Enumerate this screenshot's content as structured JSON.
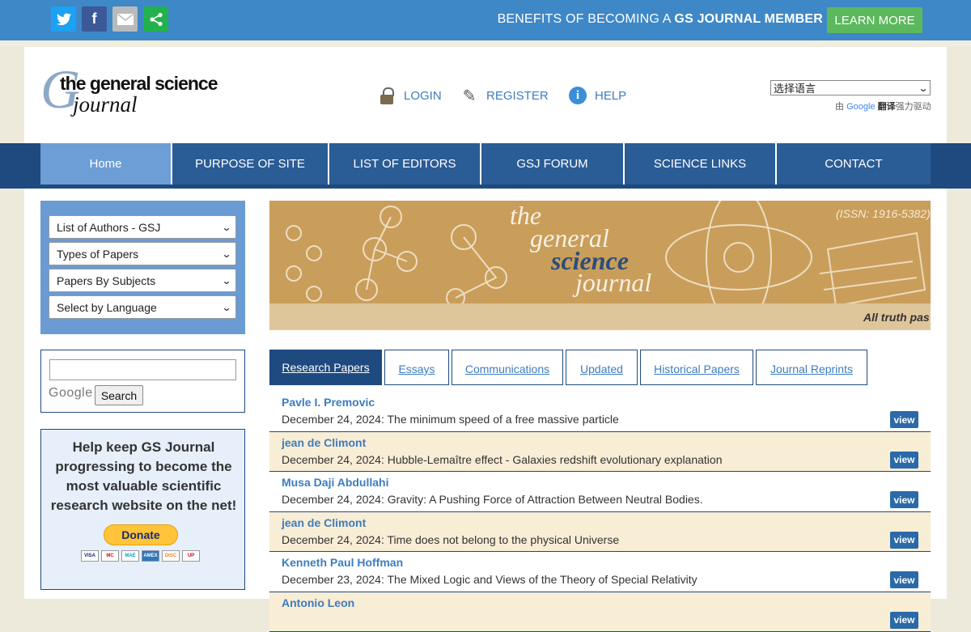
{
  "topbar": {
    "social": [
      "twitter-icon",
      "facebook-icon",
      "email-icon",
      "share-icon"
    ],
    "benefits_prefix": "BENEFITS OF BECOMING A ",
    "benefits_bold": "GS JOURNAL MEMBER",
    "learn_more": "LEARN MORE"
  },
  "logo": {
    "line1": "the general science",
    "line2": "journal"
  },
  "header_links": {
    "login": "LOGIN",
    "register": "REGISTER",
    "help": "HELP"
  },
  "translate": {
    "select_value": "选择语言",
    "powered_prefix": "由 ",
    "google": "Google",
    "translate_bold": "翻译",
    "powered_suffix": "强力驱动"
  },
  "nav": [
    {
      "label": "Home"
    },
    {
      "label": "PURPOSE OF SITE"
    },
    {
      "label": "LIST OF EDITORS"
    },
    {
      "label": "GSJ FORUM"
    },
    {
      "label": "SCIENCE LINKS"
    },
    {
      "label": "CONTACT"
    }
  ],
  "sidebar": {
    "selects": [
      "List of Authors - GSJ",
      "Types of Papers",
      "Papers By Subjects",
      "Select by Language"
    ],
    "search_button": "Search",
    "search_brand": "Google",
    "donate_text": "Help keep GS Journal progressing to become the most valuable scientific research website on the net!",
    "donate_button": "Donate",
    "cards": [
      "VISA",
      "MC",
      "MAE",
      "AMEX",
      "DISC",
      "UP"
    ]
  },
  "banner": {
    "line1": "the",
    "line2": "general",
    "line3": "science",
    "line4": "journal",
    "issn": "(ISSN: 1916-5382)",
    "tagline": "All truth pas"
  },
  "tabs": [
    "Research Papers",
    "Essays",
    "Communications",
    "Updated",
    "Historical Papers",
    "Journal Reprints"
  ],
  "papers": [
    {
      "author": "Pavle I. Premovic",
      "entry": "December 24, 2024: The minimum speed of a free massive particle",
      "view": "view"
    },
    {
      "author": "jean de Climont",
      "entry": "December 24, 2024: Hubble-Lemaître effect - Galaxies redshift evolutionary explanation",
      "view": "view"
    },
    {
      "author": "Musa Daji Abdullahi",
      "entry": "December 24, 2024: Gravity: A Pushing Force of Attraction Between Neutral Bodies.",
      "view": "view"
    },
    {
      "author": "jean de Climont",
      "entry": "December 24, 2024: Time does not belong to the physical Universe",
      "view": "view"
    },
    {
      "author": "Kenneth Paul Hoffman",
      "entry": "December 23, 2024: The Mixed Logic and Views of the Theory of Special Relativity",
      "view": "view"
    },
    {
      "author": "Antonio Leon",
      "entry": "",
      "view": "view"
    }
  ]
}
